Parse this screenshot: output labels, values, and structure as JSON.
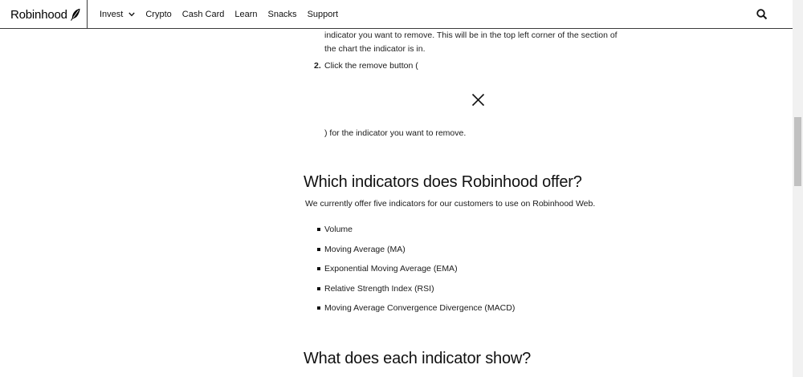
{
  "header": {
    "brand": "Robinhood",
    "nav": [
      "Invest",
      "Crypto",
      "Cash Card",
      "Learn",
      "Snacks",
      "Support"
    ]
  },
  "article": {
    "step1_line1": "indicator you want to remove. This will be in the top left corner of the section of",
    "step1_line2": "the chart the indicator is in.",
    "step2_number": "2.",
    "step2_text": "Click the remove button (",
    "step2_tail": ") for the indicator you want to remove.",
    "heading_which": "Which indicators does Robinhood offer?",
    "intro": "We currently offer five indicators for our customers to use on Robinhood Web.",
    "indicators": [
      "Volume",
      "Moving Average (MA)",
      "Exponential Moving Average (EMA)",
      "Relative Strength Index (RSI)",
      "Moving Average Convergence Divergence (MACD)"
    ],
    "heading_what": "What does each indicator show?"
  }
}
